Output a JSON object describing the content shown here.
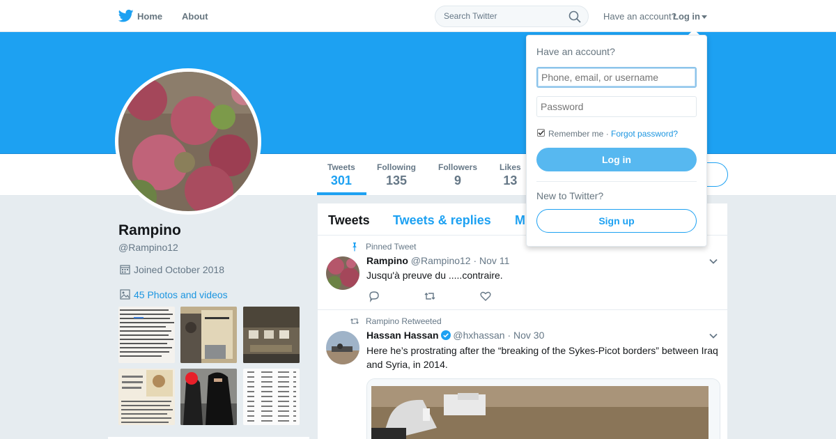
{
  "nav": {
    "home_label": "Home",
    "about_label": "About"
  },
  "search": {
    "placeholder": "Search Twitter"
  },
  "account": {
    "prompt": "Have an account?",
    "login_label": "Log in"
  },
  "profile": {
    "name": "Rampino",
    "handle": "@Rampino12",
    "joined": "Joined October 2018",
    "photos_link": "45 Photos and videos"
  },
  "stats": [
    {
      "label": "Tweets",
      "value": "301"
    },
    {
      "label": "Following",
      "value": "135"
    },
    {
      "label": "Followers",
      "value": "9"
    },
    {
      "label": "Likes",
      "value": "13"
    }
  ],
  "timeline": {
    "tabs": [
      "Tweets",
      "Tweets & replies",
      "M"
    ],
    "tweets": [
      {
        "context": "Pinned Tweet",
        "name": "Rampino",
        "handle": "@Rampino12",
        "date": "· Nov 11",
        "text": "Jusqu'à preuve du .....contraire."
      },
      {
        "context": "Rampino Retweeted",
        "name": "Hassan Hassan",
        "handle": "@hxhassan",
        "date": "· Nov 30",
        "text": "Here he’s prostrating after the “breaking of the Sykes-Picot borders” between Iraq and Syria, in 2014."
      }
    ]
  },
  "login_dropdown": {
    "title": "Have an account?",
    "username_placeholder": "Phone, email, or username",
    "password_placeholder": "Password",
    "remember_label": "Remember me ·",
    "forgot_label": "Forgot password?",
    "login_button": "Log in",
    "new_prompt": "New to Twitter?",
    "signup_button": "Sign up"
  },
  "colors": {
    "brand": "#1da1f2",
    "banner": "#1da1f2",
    "link": "#1b95e0",
    "background": "#e6ecf0"
  },
  "icons": [
    "twitter-bird-icon",
    "search-icon",
    "calendar-icon",
    "image-icon",
    "pin-icon",
    "retweet-icon",
    "reply-icon",
    "like-icon",
    "chevron-down-icon",
    "verified-icon"
  ]
}
